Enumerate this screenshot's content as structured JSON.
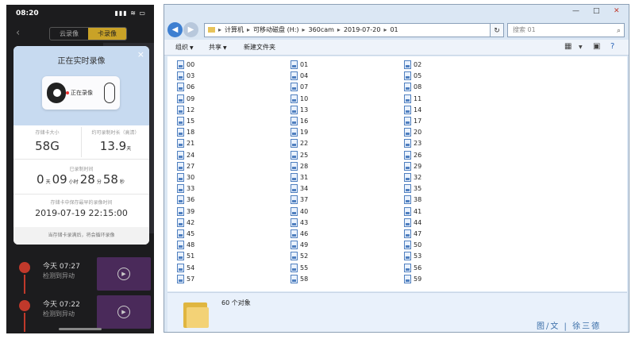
{
  "phone": {
    "status_time": "08:20",
    "status_icons": "▮▮▮ ≋ ▭",
    "back_icon": "chevron-left-icon",
    "tabs": [
      {
        "label": "云录像",
        "active": false
      },
      {
        "label": "卡录像",
        "active": true
      }
    ],
    "modal": {
      "title": "正在实时录像",
      "close": "×",
      "camera_label": "正在录像",
      "storage_label": "存储卡大小",
      "storage_value": "58G",
      "record_time_label": "约可录制时长（高清）",
      "record_time_value": "13.9",
      "record_time_unit": "天",
      "recorded_label": "已录制时间",
      "recorded": {
        "days": "0",
        "days_unit": "天",
        "hours": "09",
        "hours_unit": "小时",
        "minutes": "28",
        "minutes_unit": "分",
        "seconds": "58",
        "seconds_unit": "秒"
      },
      "earliest_label": "存储卡中保存最早的录像时间",
      "earliest_value": "2019-07-19 22:15:00",
      "footer": "当存储卡录满后，将会循环录像"
    },
    "list": [
      {
        "title": "今天 07:27",
        "sub": "检测到异动"
      },
      {
        "title": "今天 07:22",
        "sub": "检测到异动"
      }
    ]
  },
  "explorer": {
    "controls": {
      "min": "—",
      "max": "□",
      "close": "✕"
    },
    "breadcrumb": [
      "计算机",
      "可移动磁盘 (H:)",
      "360cam",
      "2019-07-20",
      "01"
    ],
    "refresh_icon": "refresh-icon",
    "search_placeholder": "搜索 01",
    "toolbar": {
      "organize": "组织",
      "share": "共享",
      "new_folder": "新建文件夹"
    },
    "files": [
      "00",
      "01",
      "02",
      "03",
      "04",
      "05",
      "06",
      "07",
      "08",
      "09",
      "10",
      "11",
      "12",
      "13",
      "14",
      "15",
      "16",
      "17",
      "18",
      "19",
      "20",
      "21",
      "22",
      "23",
      "24",
      "25",
      "26",
      "27",
      "28",
      "29",
      "30",
      "31",
      "32",
      "33",
      "34",
      "35",
      "36",
      "37",
      "38",
      "39",
      "40",
      "41",
      "42",
      "43",
      "44",
      "45",
      "46",
      "47",
      "48",
      "49",
      "50",
      "51",
      "52",
      "53",
      "54",
      "55",
      "56",
      "57",
      "58",
      "59"
    ],
    "object_count": "60 个对象"
  },
  "watermark": "图/文 | 徐三德"
}
